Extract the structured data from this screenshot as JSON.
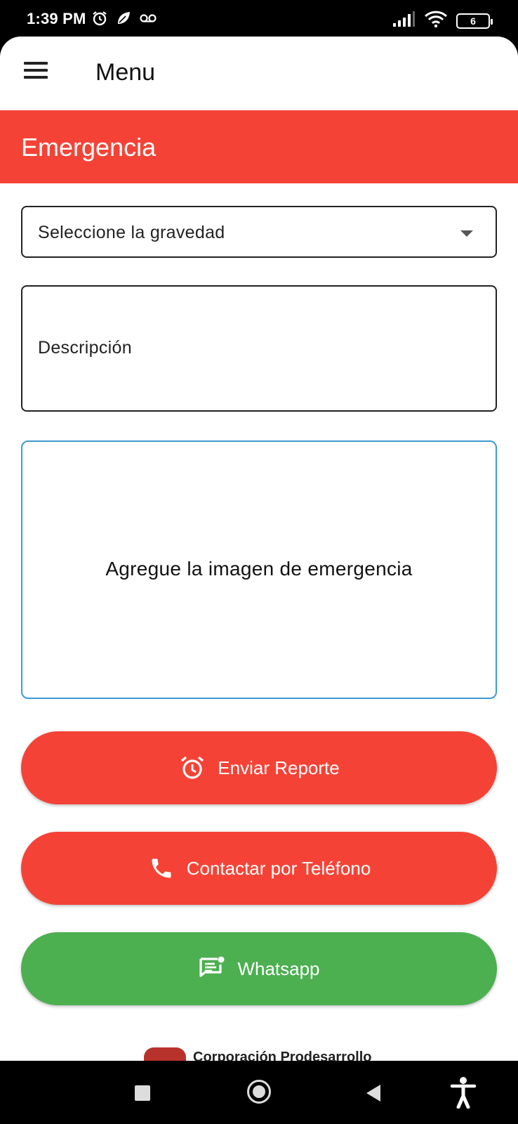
{
  "status_bar": {
    "time": "1:39 PM",
    "battery_level": "6",
    "icons_left": [
      "alarm-icon",
      "leaf-icon",
      "voicemail-icon"
    ],
    "icons_right": [
      "signal-icon",
      "wifi-icon",
      "battery-icon"
    ]
  },
  "app_bar": {
    "title": "Menu",
    "menu_icon": "hamburger-menu-icon"
  },
  "banner": {
    "title": "Emergencia",
    "color": "#f44336"
  },
  "form": {
    "severity_dropdown": {
      "label": "Seleccione la gravedad"
    },
    "description": {
      "label": "Descripción"
    },
    "image_upload": {
      "label": "Agregue la imagen de emergencia"
    }
  },
  "buttons": {
    "report": {
      "label": "Enviar Reporte",
      "icon": "alarm-clock-icon",
      "color": "#f44336"
    },
    "phone": {
      "label": "Contactar por Teléfono",
      "icon": "phone-icon",
      "color": "#f44336"
    },
    "whatsapp": {
      "label": "Whatsapp",
      "icon": "chat-message-icon",
      "color": "#4caf50"
    }
  },
  "footer": {
    "logo_text": "Corporación Prodesarrollo"
  },
  "nav_bar": {
    "icons": [
      "recent-apps-icon",
      "home-icon",
      "back-icon",
      "accessibility-icon"
    ]
  }
}
